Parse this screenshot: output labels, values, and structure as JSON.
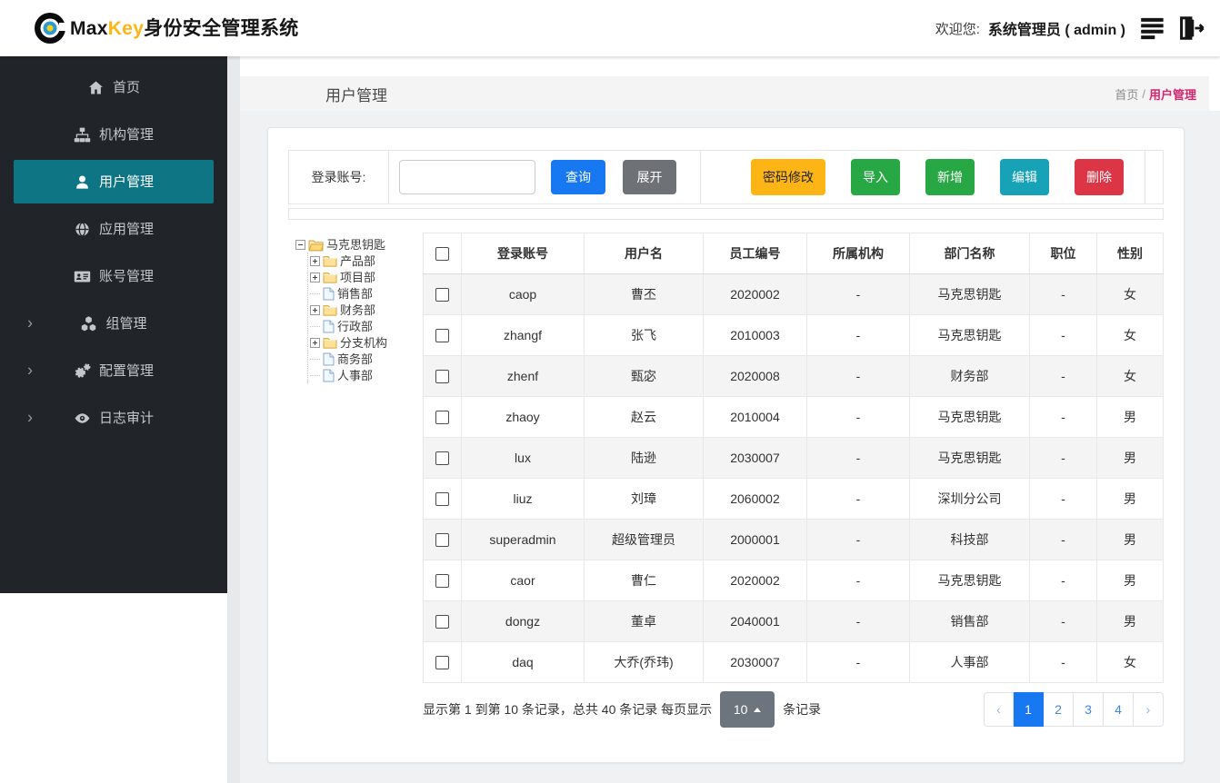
{
  "header": {
    "brand_max": "Max",
    "brand_key": "Key",
    "brand_suffix": "身份安全管理系统",
    "welcome_label": "欢迎您:",
    "user": "系统管理员 ( admin )"
  },
  "sidebar": {
    "items": [
      {
        "key": "home",
        "label": "首页",
        "icon": "home",
        "active": false,
        "expandable": false
      },
      {
        "key": "org",
        "label": "机构管理",
        "icon": "sitemap",
        "active": false,
        "expandable": false
      },
      {
        "key": "user",
        "label": "用户管理",
        "icon": "user",
        "active": true,
        "expandable": false
      },
      {
        "key": "app",
        "label": "应用管理",
        "icon": "globe",
        "active": false,
        "expandable": false
      },
      {
        "key": "account",
        "label": "账号管理",
        "icon": "idcard",
        "active": false,
        "expandable": false
      },
      {
        "key": "group",
        "label": "组管理",
        "icon": "cubes",
        "active": false,
        "expandable": true
      },
      {
        "key": "config",
        "label": "配置管理",
        "icon": "gears",
        "active": false,
        "expandable": true
      },
      {
        "key": "audit",
        "label": "日志审计",
        "icon": "eye",
        "active": false,
        "expandable": true
      }
    ]
  },
  "page": {
    "title": "用户管理",
    "breadcrumb_home": "首页",
    "breadcrumb_separator": "/",
    "breadcrumb_current": "用户管理"
  },
  "toolbar": {
    "search_label": "登录账号:",
    "search_value": "",
    "query_label": "查询",
    "expand_label": "展开",
    "actions": [
      {
        "key": "password",
        "label": "密码修改",
        "color": "#fdb515",
        "text_color": "#212529"
      },
      {
        "key": "import",
        "label": "导入",
        "color": "#28a745",
        "text_color": "#ffffff"
      },
      {
        "key": "add",
        "label": "新增",
        "color": "#28a745",
        "text_color": "#ffffff"
      },
      {
        "key": "edit",
        "label": "编辑",
        "color": "#17a2b8",
        "text_color": "#ffffff"
      },
      {
        "key": "delete",
        "label": "删除",
        "color": "#dc3545",
        "text_color": "#ffffff"
      }
    ]
  },
  "tree": {
    "root": "马克思钥匙",
    "children": [
      {
        "label": "产品部",
        "type": "folder"
      },
      {
        "label": "项目部",
        "type": "folder"
      },
      {
        "label": "销售部",
        "type": "file"
      },
      {
        "label": "财务部",
        "type": "folder"
      },
      {
        "label": "行政部",
        "type": "file"
      },
      {
        "label": "分支机构",
        "type": "folder"
      },
      {
        "label": "商务部",
        "type": "file"
      },
      {
        "label": "人事部",
        "type": "file"
      }
    ]
  },
  "table": {
    "columns": [
      "登录账号",
      "用户名",
      "员工编号",
      "所属机构",
      "部门名称",
      "职位",
      "性别"
    ],
    "rows": [
      [
        "caop",
        "曹丕",
        "2020002",
        "-",
        "马克思钥匙",
        "-",
        "女"
      ],
      [
        "zhangf",
        "张飞",
        "2010003",
        "-",
        "马克思钥匙",
        "-",
        "女"
      ],
      [
        "zhenf",
        "甄宓",
        "2020008",
        "-",
        "财务部",
        "-",
        "女"
      ],
      [
        "zhaoy",
        "赵云",
        "2010004",
        "-",
        "马克思钥匙",
        "-",
        "男"
      ],
      [
        "lux",
        "陆逊",
        "2030007",
        "-",
        "马克思钥匙",
        "-",
        "男"
      ],
      [
        "liuz",
        "刘璋",
        "2060002",
        "-",
        "深圳分公司",
        "-",
        "男"
      ],
      [
        "superadmin",
        "超级管理员",
        "2000001",
        "-",
        "科技部",
        "-",
        "男"
      ],
      [
        "caor",
        "曹仁",
        "2020002",
        "-",
        "马克思钥匙",
        "-",
        "男"
      ],
      [
        "dongz",
        "董卓",
        "2040001",
        "-",
        "销售部",
        "-",
        "男"
      ],
      [
        "daq",
        "大乔(乔玮)",
        "2030007",
        "-",
        "人事部",
        "-",
        "女"
      ]
    ]
  },
  "pagination": {
    "summary_prefix": "显示第 1 到第 10 条记录，总共 40 条记录  每页显示",
    "page_size": "10",
    "summary_suffix": "条记录",
    "prev": "‹",
    "next": "›",
    "pages": [
      "1",
      "2",
      "3",
      "4"
    ],
    "active_page": "1"
  },
  "colors": {
    "primary": "#1778f2",
    "secondary": "#6c757d",
    "success": "#28a745",
    "info": "#17a2b8",
    "danger": "#dc3545",
    "warning": "#fdb515",
    "sidebar_active": "#0e7585",
    "crumb_active": "#d6246e",
    "brand_gold": "#fdb614"
  }
}
